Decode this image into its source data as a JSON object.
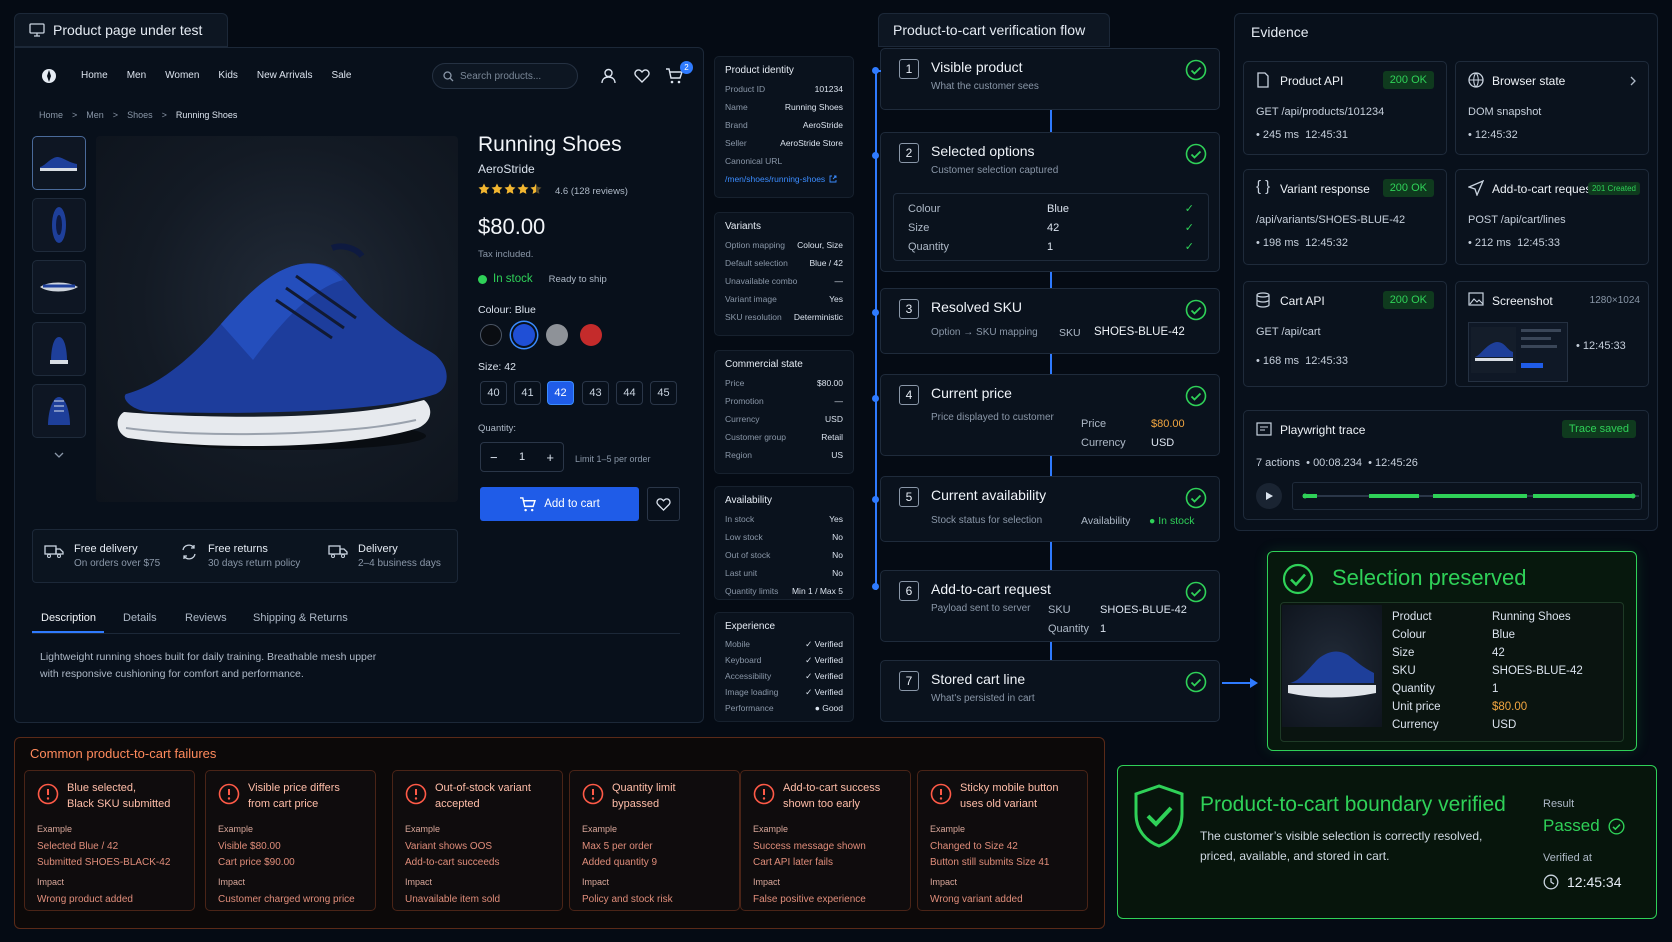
{
  "page_panel": {
    "title": "Product page under test"
  },
  "nav": {
    "items": [
      "Home",
      "Men",
      "Women",
      "Kids",
      "New Arrivals",
      "Sale"
    ],
    "search_placeholder": "Search products...",
    "cart_count": "2"
  },
  "breadcrumb": {
    "items": [
      "Home",
      "Men",
      "Shoes",
      "Running Shoes"
    ],
    "sep": ">"
  },
  "product": {
    "name": "Running Shoes",
    "brand": "AeroStride",
    "rating_text": "4.6 (128 reviews)",
    "rating": 4.6,
    "price": "$80.00",
    "tax": "Tax included.",
    "stock": "In stock",
    "ship": "Ready to ship",
    "colour_label": "Colour: Blue",
    "size_label": "Size: 42",
    "sizes": [
      "40",
      "41",
      "42",
      "43",
      "44",
      "45"
    ],
    "selected_size": "42",
    "quantity_label": "Quantity:",
    "quantity": "1",
    "qty_limit": "Limit 1–5 per order",
    "add_to_cart": "Add to cart",
    "colours": [
      "#0a0d12",
      "#1f4fd6",
      "#8e9298",
      "#c42b2b"
    ]
  },
  "features": [
    {
      "title": "Free delivery",
      "sub": "On orders over $75"
    },
    {
      "title": "Free returns",
      "sub": "30 days return policy"
    },
    {
      "title": "Delivery",
      "sub": "2–4 business days"
    }
  ],
  "tabs": [
    "Description",
    "Details",
    "Reviews",
    "Shipping & Returns"
  ],
  "description": [
    "Lightweight running shoes built for daily training. Breathable mesh upper",
    "with responsive cushioning for comfort and performance."
  ],
  "identity": {
    "title": "Product identity",
    "rows": [
      [
        "Product ID",
        "101234"
      ],
      [
        "Name",
        "Running Shoes"
      ],
      [
        "Brand",
        "AeroStride"
      ],
      [
        "Seller",
        "AeroStride Store"
      ],
      [
        "Canonical URL",
        ""
      ]
    ],
    "url": "/men/shoes/running-shoes"
  },
  "variants": {
    "title": "Variants",
    "rows": [
      [
        "Option mapping",
        "Colour, Size"
      ],
      [
        "Default selection",
        "Blue / 42"
      ],
      [
        "Unavailable combo",
        "—"
      ],
      [
        "Variant image",
        "Yes"
      ],
      [
        "SKU resolution",
        "Deterministic"
      ]
    ]
  },
  "commercial": {
    "title": "Commercial state",
    "rows": [
      [
        "Price",
        "$80.00"
      ],
      [
        "Promotion",
        "—"
      ],
      [
        "Currency",
        "USD"
      ],
      [
        "Customer group",
        "Retail"
      ],
      [
        "Region",
        "US"
      ]
    ]
  },
  "availability": {
    "title": "Availability",
    "rows": [
      [
        "In stock",
        "Yes"
      ],
      [
        "Low stock",
        "No"
      ],
      [
        "Out of stock",
        "No"
      ],
      [
        "Last unit",
        "No"
      ],
      [
        "Quantity limits",
        "Min 1 / Max 5"
      ]
    ]
  },
  "experience": {
    "title": "Experience",
    "rows": [
      [
        "Mobile",
        "Verified"
      ],
      [
        "Keyboard",
        "Verified"
      ],
      [
        "Accessibility",
        "Verified"
      ],
      [
        "Image loading",
        "Verified"
      ],
      [
        "Performance",
        "Good"
      ]
    ]
  },
  "flow": {
    "title": "Product-to-cart verification flow",
    "steps": [
      {
        "n": "1",
        "title": "Visible product",
        "sub": "What the customer sees"
      },
      {
        "n": "2",
        "title": "Selected options",
        "sub": "Customer selection captured"
      },
      {
        "n": "3",
        "title": "Resolved SKU",
        "sub": "Option → SKU mapping"
      },
      {
        "n": "4",
        "title": "Current price",
        "sub": "Price displayed to customer"
      },
      {
        "n": "5",
        "title": "Current availability",
        "sub": "Stock status for selection"
      },
      {
        "n": "6",
        "title": "Add-to-cart request",
        "sub": "Payload sent to server"
      },
      {
        "n": "7",
        "title": "Stored cart line",
        "sub": "What's persisted in cart"
      }
    ],
    "options": [
      [
        "Colour",
        "Blue"
      ],
      [
        "Size",
        "42"
      ],
      [
        "Quantity",
        "1"
      ]
    ],
    "sku": [
      "SKU",
      "SHOES-BLUE-42"
    ],
    "price": [
      [
        "Price",
        "$80.00"
      ],
      [
        "Currency",
        "USD"
      ]
    ],
    "availability": [
      "Availability",
      "In stock"
    ],
    "request": [
      [
        "SKU",
        "SHOES-BLUE-42"
      ],
      [
        "Quantity",
        "1"
      ]
    ]
  },
  "evidence": {
    "title": "Evidence",
    "product_api": {
      "title": "Product API",
      "status": "200 OK",
      "line": "GET /api/products/101234",
      "ms": "245 ms",
      "time": "12:45:31"
    },
    "browser": {
      "title": "Browser state",
      "line": "DOM snapshot",
      "time": "12:45:32"
    },
    "variant": {
      "title": "Variant response",
      "status": "200 OK",
      "line": "/api/variants/SHOES-BLUE-42",
      "ms": "198 ms",
      "time": "12:45:32"
    },
    "atc": {
      "title": "Add-to-cart request",
      "status": "201 Created",
      "line": "POST /api/cart/lines",
      "ms": "212 ms",
      "time": "12:45:33"
    },
    "cart_api": {
      "title": "Cart API",
      "status": "200 OK",
      "line": "GET /api/cart",
      "ms": "168 ms",
      "time": "12:45:33"
    },
    "screenshot": {
      "title": "Screenshot",
      "dims": "1280×1024",
      "time": "12:45:33"
    },
    "trace": {
      "title": "Playwright trace",
      "status": "Trace saved",
      "actions": "7 actions",
      "duration": "00:08.234",
      "time": "12:45:26"
    }
  },
  "preserved": {
    "title": "Selection preserved",
    "rows": [
      [
        "Product",
        "Running Shoes"
      ],
      [
        "Colour",
        "Blue"
      ],
      [
        "Size",
        "42"
      ],
      [
        "SKU",
        "SHOES-BLUE-42"
      ],
      [
        "Quantity",
        "1"
      ],
      [
        "Unit price",
        "$80.00"
      ],
      [
        "Currency",
        "USD"
      ]
    ]
  },
  "failures": {
    "title": "Common product-to-cart failures",
    "label_example": "Example",
    "label_impact": "Impact",
    "items": [
      {
        "title": [
          "Blue selected,",
          "Black SKU submitted"
        ],
        "ex": [
          "Selected Blue / 42",
          "Submitted SHOES-BLACK-42"
        ],
        "impact": "Wrong product added"
      },
      {
        "title": [
          "Visible price differs",
          "from cart price"
        ],
        "ex": [
          "Visible $80.00",
          "Cart price $90.00"
        ],
        "impact": "Customer charged wrong price"
      },
      {
        "title": [
          "Out-of-stock variant",
          "accepted"
        ],
        "ex": [
          "Variant shows OOS",
          "Add-to-cart succeeds"
        ],
        "impact": "Unavailable item sold"
      },
      {
        "title": [
          "Quantity limit",
          "bypassed"
        ],
        "ex": [
          "Max 5 per order",
          "Added quantity 9"
        ],
        "impact": "Policy and stock risk"
      },
      {
        "title": [
          "Add-to-cart success",
          "shown too early"
        ],
        "ex": [
          "Success message shown",
          "Cart API later fails"
        ],
        "impact": "False positive experience"
      },
      {
        "title": [
          "Sticky mobile button",
          "uses old variant"
        ],
        "ex": [
          "Changed to Size 42",
          "Button still submits Size 41"
        ],
        "impact": "Wrong variant added"
      }
    ]
  },
  "verified": {
    "title": "Product-to-cart boundary verified",
    "desc": [
      "The customer’s visible selection is correctly resolved,",
      "priced, available, and stored in cart."
    ],
    "result_label": "Result",
    "result": "Passed",
    "at_label": "Verified at",
    "at": "12:45:34"
  },
  "colors": {
    "accent": "#2f7bff",
    "success": "#2fd158",
    "warning": "#f2a640",
    "danger": "#ff6b5a"
  }
}
